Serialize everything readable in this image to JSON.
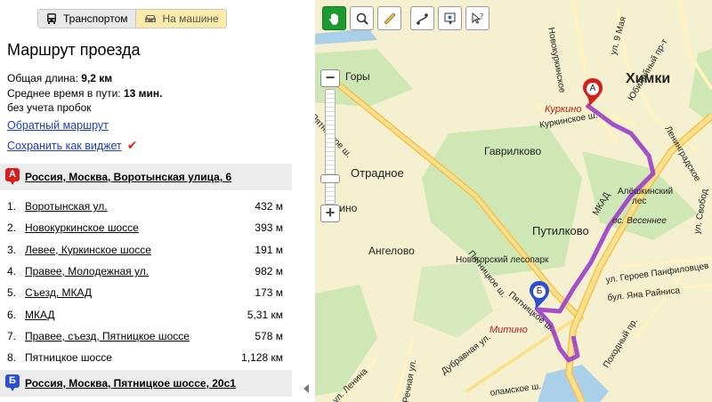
{
  "modes": {
    "transport_label": "Транспортом",
    "car_label": "На машине"
  },
  "route": {
    "title": "Маршрут проезда",
    "length_label": "Общая длина:",
    "length_value": "9,2 км",
    "time_label": "Среднее время в пути:",
    "time_value": "13 мин.",
    "traffic_note": "без учета пробок",
    "reverse_link": "Обратный маршрут",
    "widget_link": "Сохранить как виджет",
    "widget_check": "✔"
  },
  "start": {
    "marker": "А",
    "address": "Россия, Москва, Воротынская улица, 6"
  },
  "end": {
    "marker": "Б",
    "address": "Россия, Москва, Пятницкое шоссе, 20с1"
  },
  "steps": [
    {
      "num": "1.",
      "name": "Воротынская ул.",
      "dist": "432 м",
      "link": true
    },
    {
      "num": "2.",
      "name": "Новокуркинское шоссе",
      "dist": "393 м",
      "link": true
    },
    {
      "num": "3.",
      "name": "Левее, Куркинское шоссе",
      "dist": "191 м",
      "link": true
    },
    {
      "num": "4.",
      "name": "Правее, Молодежная ул.",
      "dist": "982 м",
      "link": true
    },
    {
      "num": "5.",
      "name": "Съезд, МКАД",
      "dist": "173 м",
      "link": true
    },
    {
      "num": "6.",
      "name": "МКАД",
      "dist": "5,31 км",
      "link": true
    },
    {
      "num": "7.",
      "name": "Правее, съезд, Пятницкое шоссе",
      "dist": "578 м",
      "link": true
    },
    {
      "num": "8.",
      "name": "Пятницкое шоссе",
      "dist": "1,128 км",
      "link": false
    }
  ],
  "map": {
    "zoom_in": "+",
    "zoom_out": "−",
    "zoom_level": 0.2,
    "pin_a": "А",
    "pin_b": "Б",
    "labels": {
      "khimki": "Химки",
      "kurkino": "Куркино",
      "gory": "Горы",
      "gavrilkovo": "Гаврилково",
      "otradnoe": "Отрадное",
      "putilkovo": "Путилково",
      "angelovo": "Ангелово",
      "aleshkinsky": "Алёшкинский",
      "les": "лес",
      "vesennee": "ос. Весеннее",
      "novogorsky": "Новогорский лесопарк",
      "mitino": "Митино",
      "mkad": "МКАД",
      "pyatnitskoe1": "Пятницкое ш.",
      "pyatnitskoe2": "Пятницкое ш.",
      "pyatnitskoe3": "Пятницкое ш.",
      "kurkinskoe": "Куркинское ш.",
      "yubileyny": "Юбилейный пр-т",
      "may9": "ул. 9 Мая",
      "novokurk": "Новокуркинское",
      "leningr": "Ленинградское",
      "geroev": "ул. Героев Панфиловцев",
      "raynis": "бул. Яна Райниса",
      "pokhodny": "Походный пр.",
      "dubravnaya": "Дубравная ул.",
      "rechnaya": "Речная ул.",
      "lenina": "ул. Ленина",
      "arino": "арино",
      "svobody": "ул. Свобод",
      "volokolamskoe": "оламское ш."
    }
  },
  "colors": {
    "route": "#9b3fc8",
    "pin_a": "#d4201d",
    "pin_b": "#2a4fd0",
    "active_tool": "#1d9a2f",
    "link": "#1a3dc1"
  }
}
